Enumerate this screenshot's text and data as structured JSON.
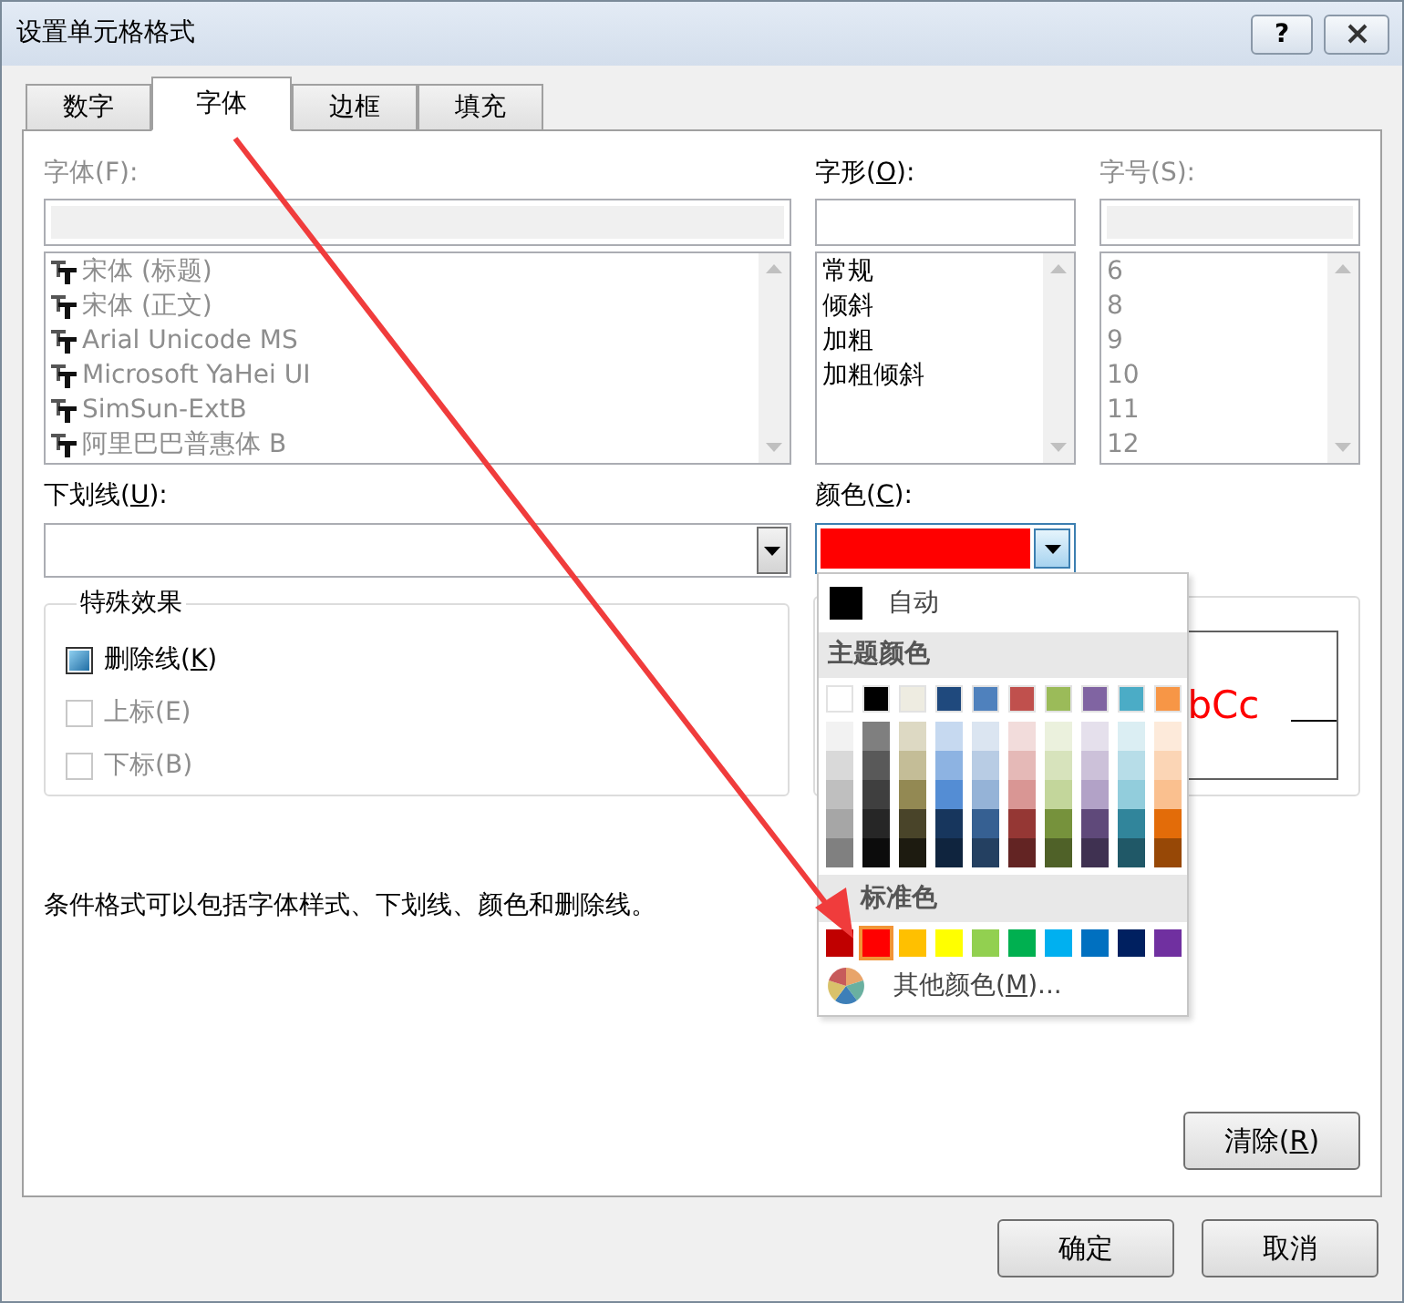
{
  "window": {
    "title": "设置单元格格式",
    "help_button": "?"
  },
  "tabs": [
    {
      "label": "数字",
      "selected": false
    },
    {
      "label": "字体",
      "selected": true
    },
    {
      "label": "边框",
      "selected": false
    },
    {
      "label": "填充",
      "selected": false
    }
  ],
  "font": {
    "label": [
      "字体(F):"
    ],
    "disabled": true,
    "items": [
      "宋体 (标题)",
      "宋体 (正文)",
      "Arial Unicode MS",
      "Microsoft YaHei UI",
      "SimSun-ExtB",
      "阿里巴巴普惠体 B"
    ]
  },
  "font_style": {
    "label": [
      "字形(",
      "O",
      "):"
    ],
    "disabled": false,
    "items": [
      "常规",
      "倾斜",
      "加粗",
      "加粗倾斜"
    ]
  },
  "size": {
    "label": [
      "字号(S):"
    ],
    "disabled": true,
    "items": [
      "6",
      "8",
      "9",
      "10",
      "11",
      "12"
    ]
  },
  "underline": {
    "label": [
      "下划线(",
      "U",
      "):"
    ]
  },
  "color": {
    "label": [
      "颜色(",
      "C",
      "):"
    ],
    "color": "#ff0000",
    "expanded": true
  },
  "effects": {
    "title": "特殊效果",
    "options": [
      {
        "label": [
          "删除线(",
          "K",
          ")"
        ],
        "checked": true,
        "disabled": false
      },
      {
        "label": [
          "上标(E)"
        ],
        "checked": false,
        "disabled": true
      },
      {
        "label": [
          "下标(B)"
        ],
        "checked": false,
        "disabled": true
      }
    ]
  },
  "preview": {
    "text": "bCc"
  },
  "note": "条件格式可以包括字体样式、下划线、颜色和删除线。",
  "clear_button": [
    "清除(",
    "R",
    ")"
  ],
  "color_popup": {
    "auto": {
      "label": "自动",
      "color": "#000000"
    },
    "theme_title": "主题颜色",
    "theme_colors": [
      {
        "color": "#ffffff",
        "shades": [
          {
            "color": "#f2f2f2"
          },
          {
            "color": "#d9d9d9"
          },
          {
            "color": "#bfbfbf"
          },
          {
            "color": "#a6a6a6"
          },
          {
            "color": "#808080"
          }
        ]
      },
      {
        "color": "#000000",
        "shades": [
          {
            "color": "#7f7f7f"
          },
          {
            "color": "#595959"
          },
          {
            "color": "#3f3f3f"
          },
          {
            "color": "#262626"
          },
          {
            "color": "#0c0c0c"
          }
        ]
      },
      {
        "color": "#eeece1",
        "shades": [
          {
            "color": "#ddd9c3"
          },
          {
            "color": "#c4bd97"
          },
          {
            "color": "#938953"
          },
          {
            "color": "#494429"
          },
          {
            "color": "#1d1b10"
          }
        ]
      },
      {
        "color": "#1f497d",
        "shades": [
          {
            "color": "#c6d9f0"
          },
          {
            "color": "#8db3e2"
          },
          {
            "color": "#548dd4"
          },
          {
            "color": "#17365d"
          },
          {
            "color": "#0f243e"
          }
        ]
      },
      {
        "color": "#4f81bd",
        "shades": [
          {
            "color": "#dbe5f1"
          },
          {
            "color": "#b8cce4"
          },
          {
            "color": "#95b3d7"
          },
          {
            "color": "#366092"
          },
          {
            "color": "#244061"
          }
        ]
      },
      {
        "color": "#c0504d",
        "shades": [
          {
            "color": "#f2dcdb"
          },
          {
            "color": "#e5b9b7"
          },
          {
            "color": "#d99694"
          },
          {
            "color": "#953734"
          },
          {
            "color": "#632423"
          }
        ]
      },
      {
        "color": "#9bbb59",
        "shades": [
          {
            "color": "#ebf1dd"
          },
          {
            "color": "#d7e3bc"
          },
          {
            "color": "#c3d69b"
          },
          {
            "color": "#76923c"
          },
          {
            "color": "#4f6128"
          }
        ]
      },
      {
        "color": "#8064a2",
        "shades": [
          {
            "color": "#e5e0ec"
          },
          {
            "color": "#ccc1d9"
          },
          {
            "color": "#b2a2c7"
          },
          {
            "color": "#5f497a"
          },
          {
            "color": "#3f3151"
          }
        ]
      },
      {
        "color": "#4bacc6",
        "shades": [
          {
            "color": "#dbeef3"
          },
          {
            "color": "#b7dde8"
          },
          {
            "color": "#92cddc"
          },
          {
            "color": "#31859b"
          },
          {
            "color": "#205867"
          }
        ]
      },
      {
        "color": "#f79646",
        "shades": [
          {
            "color": "#fdeada"
          },
          {
            "color": "#fbd5b5"
          },
          {
            "color": "#fac08f"
          },
          {
            "color": "#e36c09"
          },
          {
            "color": "#974806"
          }
        ]
      }
    ],
    "standard_title": "标准色",
    "standard_colors": [
      {
        "color": "#c00000",
        "selected": false
      },
      {
        "color": "#ff0000",
        "selected": true
      },
      {
        "color": "#ffc000",
        "selected": false
      },
      {
        "color": "#ffff00",
        "selected": false
      },
      {
        "color": "#92d050",
        "selected": false
      },
      {
        "color": "#00b050",
        "selected": false
      },
      {
        "color": "#00b0f0",
        "selected": false
      },
      {
        "color": "#0070c0",
        "selected": false
      },
      {
        "color": "#002060",
        "selected": false
      },
      {
        "color": "#7030a0",
        "selected": false
      }
    ],
    "more": [
      "其他颜色(",
      "M",
      ")..."
    ]
  },
  "buttons": [
    {
      "label": "确定"
    },
    {
      "label": "取消"
    }
  ]
}
